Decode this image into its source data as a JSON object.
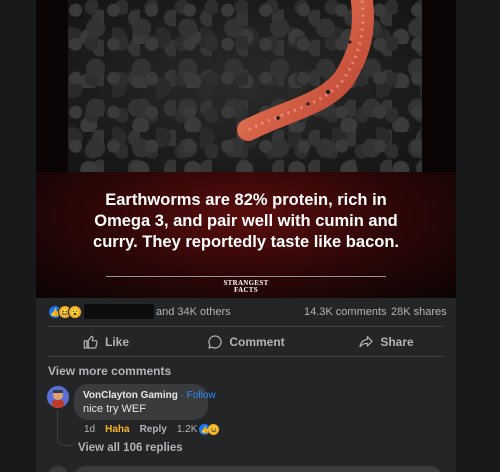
{
  "post": {
    "caption": "Earthworms are 82% protein, rich in Omega 3, and pair well with cumin and curry. They reportedly taste like bacon.",
    "brand_line1": "STRANGEST",
    "brand_line2": "FACTS"
  },
  "stats": {
    "others": "and 34K others",
    "comments": "14.3K comments",
    "shares": "28K shares"
  },
  "actions": {
    "like": "Like",
    "comment": "Comment",
    "share": "Share"
  },
  "comments": {
    "view_more": "View more comments",
    "items": [
      {
        "author": "VonClayton Gaming",
        "follow": "Follow",
        "text": "nice try WEF",
        "time": "1d",
        "reaction": "Haha",
        "reply": "Reply",
        "reaction_count": "1.2K",
        "view_replies": "View all 106 replies"
      }
    ]
  },
  "icons": [
    "like-icon",
    "comment-icon",
    "share-icon",
    "haha-reaction-icon",
    "wow-reaction-icon"
  ],
  "colors": {
    "background": "#18191a",
    "card": "#242526",
    "accent": "#2d88ff",
    "haha": "#f7b125"
  }
}
